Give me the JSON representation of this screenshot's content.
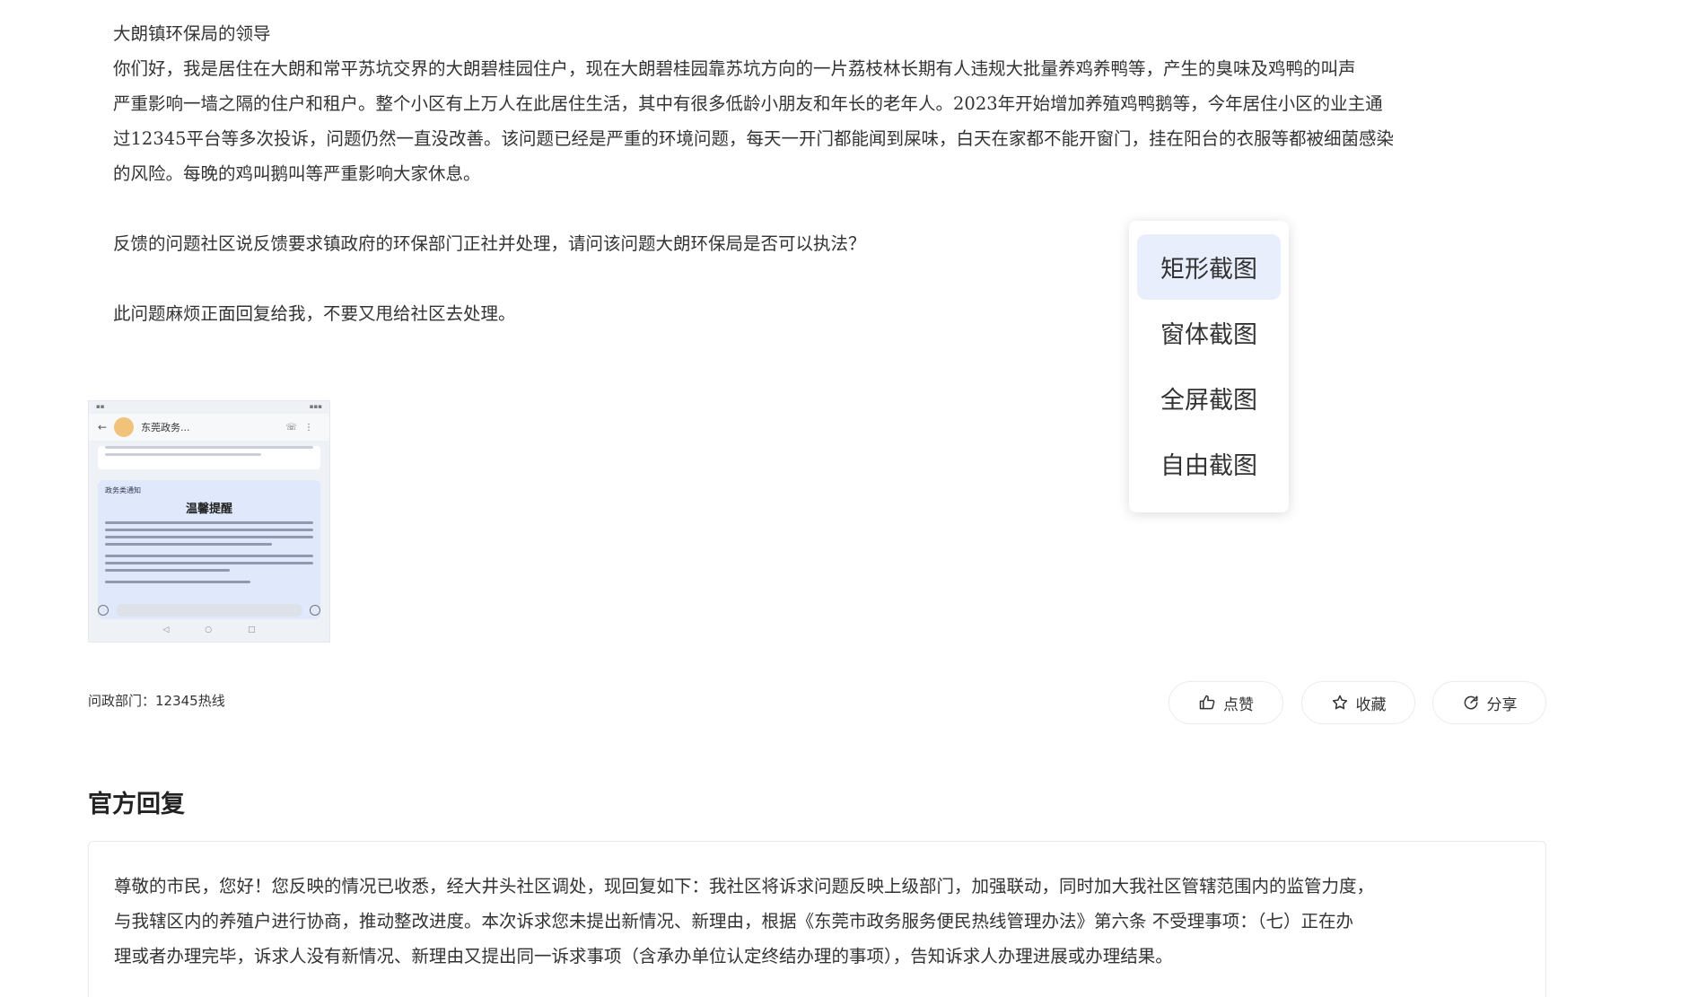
{
  "complaint": {
    "recipient": "大朗镇环保局的领导",
    "lines": [
      "你们好，我是居住在大朗和常平苏坑交界的大朗碧桂园住户，现在大朗碧桂园靠苏坑方向的一片荔枝林长期有人违规大批量养鸡养鸭等，产生的臭味及鸡鸭的叫声",
      "严重影响一墙之隔的住户和租户。整个小区有上万人在此居住生活，其中有很多低龄小朋友和年长的老年人。2023年开始增加养殖鸡鸭鹅等，今年居住小区的业主通",
      "过12345平台等多次投诉，问题仍然一直没改善。该问题已经是严重的环境问题，每天一开门都能闻到屎味，白天在家都不能开窗门，挂在阳台的衣服等都被细菌感染",
      "的风险。每晚的鸡叫鹅叫等严重影响大家休息。"
    ],
    "paragraph2": "反馈的问题社区说反馈要求镇政府的环保部门正社并处理，请问该问题大朗环保局是否可以执法？",
    "paragraph3": "此问题麻烦正面回复给我，不要又甩给社区去处理。"
  },
  "thumbnail": {
    "chat_title": "东莞政务...",
    "notice_label": "政务类通知",
    "notice_heading": "温馨提醒"
  },
  "department": "问政部门：12345热线",
  "actions": {
    "like": "点赞",
    "favorite": "收藏",
    "share": "分享"
  },
  "reply": {
    "title": "官方回复",
    "lines": [
      "尊敬的市民，您好！您反映的情况已收悉，经大井头社区调处，现回复如下：我社区将诉求问题反映上级部门，加强联动，同时加大我社区管辖范围内的监管力度，",
      "与我辖区内的养殖户进行协商，推动整改进度。本次诉求您未提出新情况、新理由，根据《东莞市政务服务便民热线管理办法》第六条 不受理事项：（七）正在办",
      "理或者办理完毕，诉求人没有新情况、新理由又提出同一诉求事项（含承办单位认定终结办理的事项），告知诉求人办理进展或办理结果。"
    ]
  },
  "screenshot_menu": {
    "items": [
      {
        "label": "矩形截图",
        "active": true
      },
      {
        "label": "窗体截图",
        "active": false
      },
      {
        "label": "全屏截图",
        "active": false
      },
      {
        "label": "自由截图",
        "active": false
      }
    ]
  },
  "colors": {
    "text": "#333333",
    "menu_highlight": "#e8eefb",
    "border": "#e9ecf1"
  }
}
